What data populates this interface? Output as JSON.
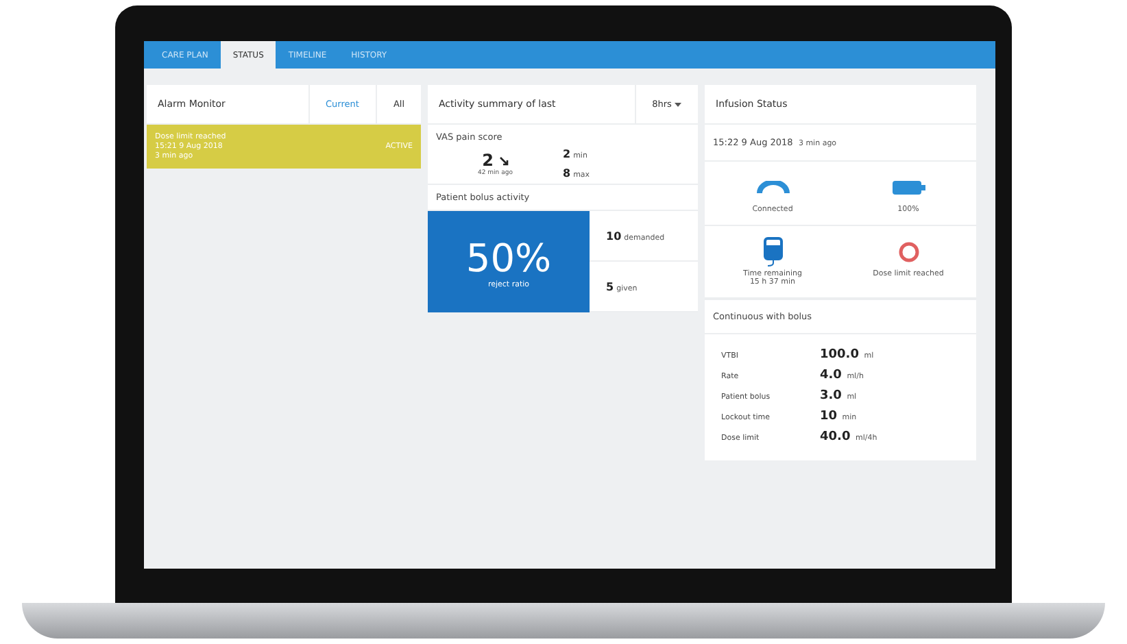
{
  "tabs": [
    {
      "label": "CARE PLAN",
      "selected": false
    },
    {
      "label": "STATUS",
      "selected": true
    },
    {
      "label": "TIMELINE",
      "selected": false
    },
    {
      "label": "HISTORY",
      "selected": false
    }
  ],
  "alarm_monitor": {
    "title": "Alarm Monitor",
    "filters": [
      {
        "label": "Current",
        "selected": true
      },
      {
        "label": "All",
        "selected": false
      }
    ],
    "alarms": [
      {
        "title": "Dose limit reached",
        "time": "15:21 9 Aug 2018",
        "ago": "3 min ago",
        "status": "ACTIVE",
        "active": true
      }
    ]
  },
  "activity": {
    "title": "Activity summary of last",
    "period": "8hrs",
    "vas": {
      "title": "VAS pain score",
      "score": "2",
      "ago": "42 min ago",
      "stats": [
        {
          "value": "2",
          "label": "min"
        },
        {
          "value": "8",
          "label": "max"
        }
      ]
    },
    "bolus": {
      "title": "Patient bolus activity",
      "percent": "50%",
      "caption": "reject ratio",
      "stats": [
        {
          "value": "10",
          "label": "demanded"
        },
        {
          "value": "5",
          "label": "given"
        }
      ]
    }
  },
  "infusion": {
    "title": "Infusion Status",
    "time": "15:22 9 Aug 2018",
    "ago": "3 min ago",
    "indicators": [
      {
        "kind": "connection",
        "label": "Connected"
      },
      {
        "kind": "battery",
        "label": "100%"
      },
      {
        "kind": "bag",
        "label": "Time remaining",
        "detail": "15 h 37 min"
      },
      {
        "kind": "alert",
        "label": "Dose limit reached"
      }
    ],
    "mode": "Continuous with bolus",
    "params": [
      {
        "label": "VTBI",
        "value": "100.0",
        "unit": "ml"
      },
      {
        "label": "Rate",
        "value": "4.0",
        "unit": "ml/h"
      },
      {
        "label": "Patient bolus",
        "value": "3.0",
        "unit": "ml"
      },
      {
        "label": "Lockout time",
        "value": "10",
        "unit": "min"
      },
      {
        "label": "Dose limit",
        "value": "40.0",
        "unit": "ml/4h"
      }
    ]
  }
}
